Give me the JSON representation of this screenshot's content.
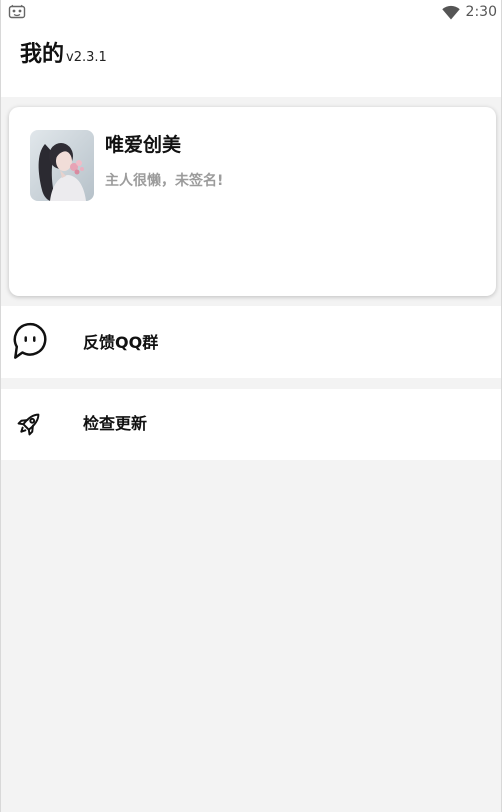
{
  "status_bar": {
    "time": "2:30",
    "left_icon": "notification-icon",
    "right_icon": "wifi-icon"
  },
  "header": {
    "title": "我的",
    "version": "v2.3.1"
  },
  "profile": {
    "name": "唯爱创美",
    "signature": "主人很懒，未签名!"
  },
  "menu": [
    {
      "label": "反馈QQ群",
      "icon": "chat-bubble-icon"
    },
    {
      "label": "检查更新",
      "icon": "rocket-icon"
    }
  ],
  "colors": {
    "page_background": "#f3f3f3",
    "surface": "#ffffff",
    "text_primary": "#111111",
    "text_secondary": "#9c9c9c"
  }
}
